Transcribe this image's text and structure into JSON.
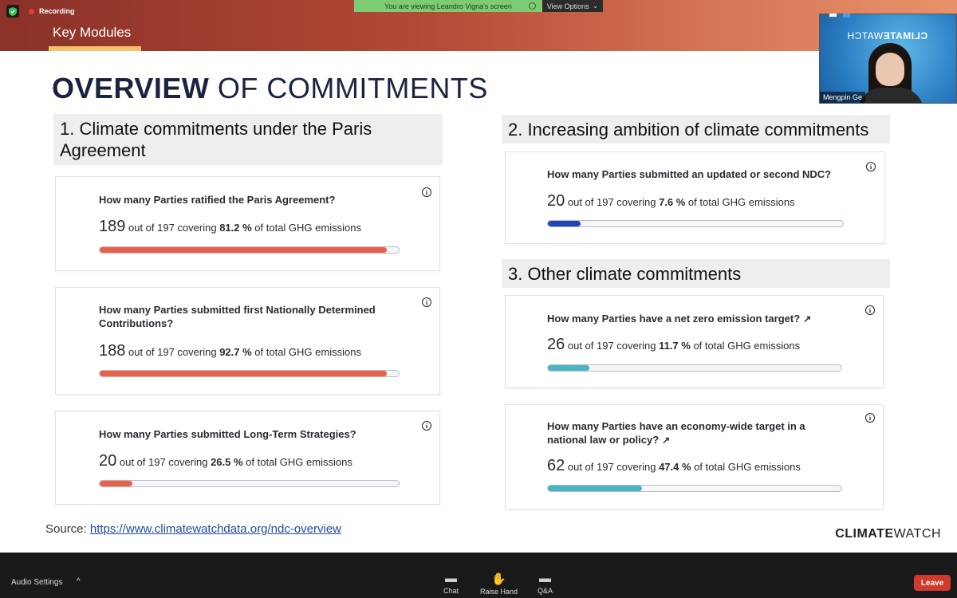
{
  "zoom": {
    "recording_label": "Recording",
    "viewing_banner": "You are viewing Leandro Vigna's screen",
    "view_options": "View Options",
    "webcam_brand_bold": "CLIMATE",
    "webcam_brand_light": "WATCH",
    "participant_name": "Mengpin Ge",
    "toolbar": {
      "audio_settings": "Audio Settings",
      "chat": "Chat",
      "raise_hand": "Raise Hand",
      "qa": "Q&A",
      "leave": "Leave"
    }
  },
  "header": {
    "tab": "Key Modules"
  },
  "title": {
    "bold": "OVERVIEW",
    "rest": " OF COMMITMENTS"
  },
  "sections": [
    {
      "heading": "1. Climate commitments under the Paris Agreement"
    },
    {
      "heading": "2. Increasing ambition of climate commitments"
    },
    {
      "heading": "3. Other climate commitments"
    }
  ],
  "cards": [
    {
      "question": "How many Parties ratified the Paris Agreement?",
      "count": "189",
      "total_text": " out of 197 covering ",
      "pct": "81.2 %",
      "suffix": " of total GHG emissions",
      "progress": 0.96,
      "color": "#e8624a"
    },
    {
      "question": "How many Parties submitted first Nationally Determined Contributions?",
      "count": "188",
      "total_text": " out of 197 covering ",
      "pct": "92.7 %",
      "suffix": " of total GHG emissions",
      "progress": 0.96,
      "color": "#e8624a"
    },
    {
      "question": "How many Parties submitted Long-Term Strategies?",
      "count": "20",
      "total_text": " out of 197 covering ",
      "pct": "26.5 %",
      "suffix": " of total GHG emissions",
      "progress": 0.11,
      "color": "#e8624a"
    },
    {
      "question": "How many Parties submitted an updated or second NDC?",
      "count": "20",
      "total_text": " out of 197 covering ",
      "pct": "7.6 %",
      "suffix": " of total GHG emissions",
      "progress": 0.11,
      "color": "#1d45b8"
    },
    {
      "question": "How many Parties have a net zero emission target?",
      "count": "26",
      "total_text": " out of 197 covering ",
      "pct": "11.7 %",
      "suffix": " of total GHG emissions",
      "progress": 0.14,
      "color": "#45b6c2"
    },
    {
      "question": "How many Parties have an economy-wide target in a national law or policy?",
      "count": "62",
      "total_text": " out of 197 covering ",
      "pct": "47.4 %",
      "suffix": " of total GHG emissions",
      "progress": 0.32,
      "color": "#45b6c2"
    }
  ],
  "footer": {
    "source_label": "Source: ",
    "source_url": "https://www.climatewatchdata.org/ndc-overview",
    "brand_bold": "CLIMATE",
    "brand_light": "WATCH"
  },
  "info_glyph": "i",
  "ext_glyph": "↗"
}
